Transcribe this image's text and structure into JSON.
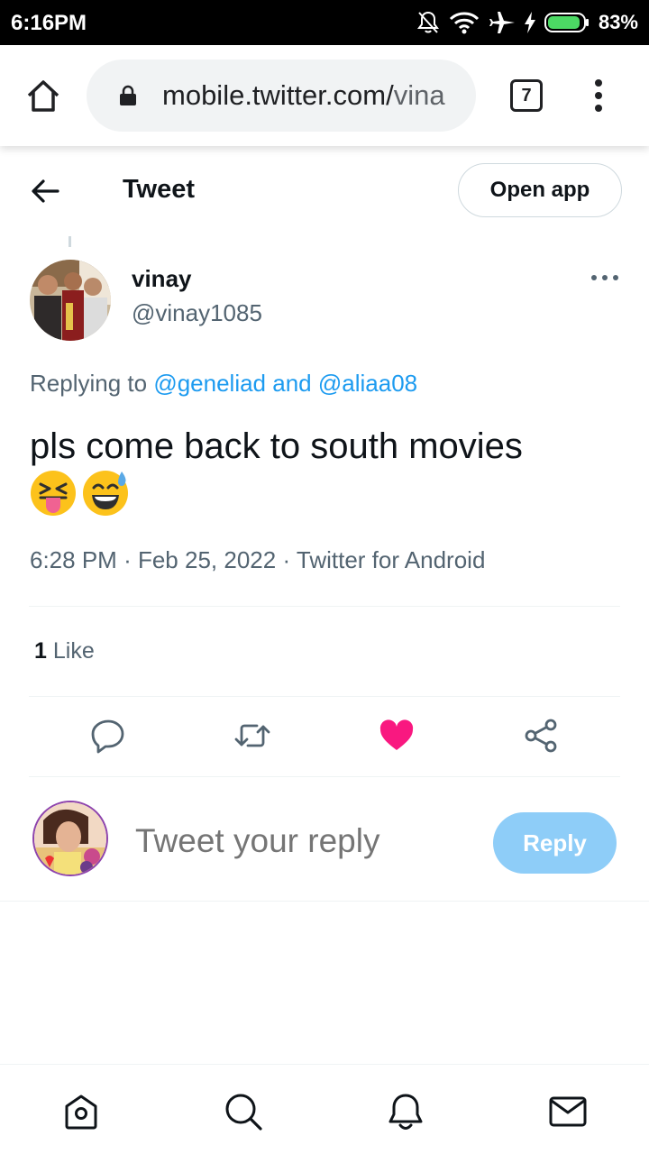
{
  "status_bar": {
    "time": "6:16PM",
    "battery_percent": "83%",
    "icons": [
      "mute-icon",
      "wifi-icon",
      "airplane-icon",
      "charging-icon",
      "battery-icon"
    ]
  },
  "browser": {
    "url_host": "mobile.twitter.com/",
    "url_path": "vina",
    "tab_count": "7"
  },
  "header": {
    "title": "Tweet",
    "open_app_label": "Open app"
  },
  "tweet": {
    "author_name": "vinay",
    "author_handle": "@vinay1085",
    "replying_prefix": "Replying to",
    "replying_mention_1": "@geneliad",
    "replying_and": "and",
    "replying_mention_2": "@aliaa08",
    "text": "pls come back to south movies",
    "emojis": [
      "squinting-tongue-emoji",
      "grinning-sweat-emoji"
    ],
    "time": "6:28 PM",
    "date": "Feb 25, 2022",
    "source": "Twitter for Android",
    "separator": "·",
    "like_count": "1",
    "like_label": "Like"
  },
  "reply": {
    "placeholder": "Tweet your reply",
    "button_label": "Reply"
  },
  "colors": {
    "accent": "#1d9bf0",
    "like": "#f91880",
    "reply_button": "#8ecdf8",
    "secondary_text": "#536471"
  },
  "bottom_nav": [
    "home-icon",
    "search-icon",
    "notifications-icon",
    "messages-icon"
  ]
}
